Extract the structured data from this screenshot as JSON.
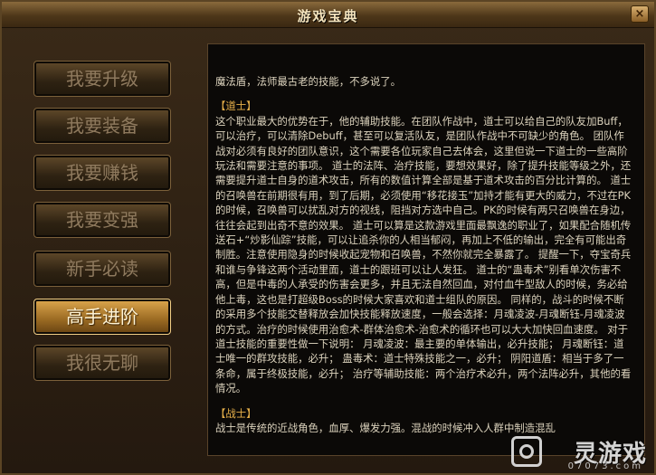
{
  "window": {
    "title": "游戏宝典",
    "close_label": "×"
  },
  "menu": {
    "items": [
      {
        "label": "我要升级"
      },
      {
        "label": "我要装备"
      },
      {
        "label": "我要赚钱"
      },
      {
        "label": "我要变强"
      },
      {
        "label": "新手必读"
      },
      {
        "label": "高手进阶"
      },
      {
        "label": "我很无聊"
      }
    ],
    "active_index": 5
  },
  "content": {
    "intro": "魔法盾，法师最古老的技能，不多说了。",
    "sections": [
      {
        "heading": "【道士】",
        "text": "这个职业最大的优势在于，他的辅助技能。在团队作战中，道士可以给自己的队友加Buff，可以治疗，可以清除Debuff，甚至可以复活队友，是团队作战中不可缺少的角色。 团队作战对必须有良好的团队意识，这个需要各位玩家自己去体会，这里但说一下道士的一些高阶玩法和需要注意的事项。 道士的法阵、治疗技能，要想效果好，除了提升技能等级之外，还需要提升道士自身的道术攻击，所有的数值计算全部是基于道术攻击的百分比计算的。 道士的召唤兽在前期很有用，到了后期，必须使用“移花接玉”加持才能有更大的威力，不过在PK的时候，召唤兽可以扰乱对方的视线，阻挡对方选中自己。PK的时候有两只召唤兽在身边，往往会起到出奇不意的效果。 道士可以算是这款游戏里面最飘逸的职业了，如果配合随机传送石+“炒影仙踪”技能，可以让追杀你的人相当郁闷，再加上不低的输出，完全有可能出奇制胜。注意使用隐身的时候收起宠物和召唤兽，不然你就完全暴露了。 提醒一下，夺宝奇兵和谁与争锋这两个活动里面，道士的跟班可以让人发狂。 道士的“蛊毒术”别看单次伤害不高，但是中毒的人承受的伤害会更多，并且无法自然回血，对付血牛型敌人的时候，务必给他上毒，这也是打超级Boss的时候大家喜欢和道士组队的原因。 同样的，战斗的时候不断的采用多个技能交替释放会加快技能释放速度，一般会选择：月魂凌波-月魂断钰-月魂凌波的方式。治疗的时候使用治愈术-群体治愈术-治愈术的循环也可以大大加快回血速度。 对于道士技能的重要性做一下说明： 月魂凌波：最主要的单体输出，必升技能； 月魂断钰：道士唯一的群攻技能，必升； 蛊毒术：道士特殊技能之一，必升； 阴阳道盾：相当于多了一条命，属于终极技能，必升； 治疗等辅助技能：两个治疗术必升，两个法阵必升，其他的看情况。"
      },
      {
        "heading": "【战士】",
        "text": "战士是传统的近战角色，血厚、爆发力强。混战的时候冲入人群中制造混乱"
      }
    ]
  },
  "watermark": {
    "brand": "灵游戏",
    "url": "07073.com"
  }
}
